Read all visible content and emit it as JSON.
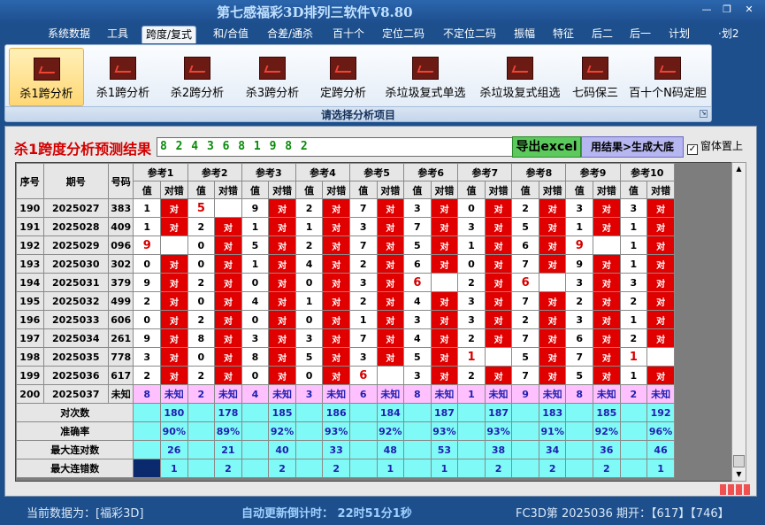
{
  "window": {
    "title": "第七感福彩3D排列三软件V8.80",
    "controls": [
      "—",
      "❐",
      "✕"
    ],
    "extra_tab": "·划2"
  },
  "menu": [
    "系统数据",
    "工具",
    "跨度/复式",
    "和/合值",
    "合差/通杀",
    "百十个",
    "定位二码",
    "不定位二码",
    "振幅",
    "特征",
    "后二",
    "后一",
    "计划"
  ],
  "menu_active_index": 2,
  "ribbon": {
    "buttons": [
      "杀1跨分析",
      "杀1跨分析",
      "杀2跨分析",
      "杀3跨分析",
      "定跨分析",
      "杀垃圾复式单选",
      "杀垃圾复式组选",
      "七码保三",
      "百十个N码定胆"
    ],
    "active_index": 0,
    "group_label": "请选择分析项目",
    "icon": "chart-icon"
  },
  "main": {
    "result_label": "杀1跨度分析预测结果",
    "result_value": "8 2 4 3 6 8 1 9 8 2",
    "export_button": "导出excel",
    "generate_button": "用结果>生成大底",
    "topmost_checkbox_label": "窗体置上",
    "topmost_checked": true
  },
  "table": {
    "headers": {
      "seq": "序号",
      "period": "期号",
      "code": "号码",
      "refs": [
        "参考1",
        "参考2",
        "参考3",
        "参考4",
        "参考5",
        "参考6",
        "参考7",
        "参考8",
        "参考9",
        "参考10"
      ],
      "sub_value": "值",
      "sub_result": "对错"
    },
    "hit_text": "对",
    "rows": [
      {
        "seq": "190",
        "period": "2025027",
        "code": "383",
        "vals": [
          "1",
          "5",
          "9",
          "2",
          "7",
          "3",
          "0",
          "2",
          "3",
          "3"
        ],
        "hits": [
          true,
          false,
          true,
          true,
          true,
          true,
          true,
          true,
          true,
          true
        ],
        "miss_highlight": [
          false,
          true,
          false,
          false,
          false,
          false,
          false,
          false,
          false,
          false
        ]
      },
      {
        "seq": "191",
        "period": "2025028",
        "code": "409",
        "vals": [
          "1",
          "2",
          "1",
          "1",
          "3",
          "7",
          "3",
          "5",
          "1",
          "1"
        ],
        "hits": [
          true,
          true,
          true,
          true,
          true,
          true,
          true,
          true,
          true,
          true
        ],
        "miss_highlight": [
          false,
          false,
          false,
          false,
          false,
          false,
          false,
          false,
          false,
          false
        ]
      },
      {
        "seq": "192",
        "period": "2025029",
        "code": "096",
        "vals": [
          "9",
          "0",
          "5",
          "2",
          "7",
          "5",
          "1",
          "6",
          "9",
          "1"
        ],
        "hits": [
          false,
          true,
          true,
          true,
          true,
          true,
          true,
          true,
          false,
          true
        ],
        "miss_highlight": [
          true,
          false,
          false,
          false,
          false,
          false,
          false,
          false,
          true,
          false
        ]
      },
      {
        "seq": "193",
        "period": "2025030",
        "code": "302",
        "vals": [
          "0",
          "0",
          "1",
          "4",
          "2",
          "6",
          "0",
          "7",
          "9",
          "1"
        ],
        "hits": [
          true,
          true,
          true,
          true,
          true,
          true,
          true,
          true,
          true,
          true
        ],
        "miss_highlight": [
          false,
          false,
          false,
          false,
          false,
          false,
          false,
          false,
          false,
          false
        ]
      },
      {
        "seq": "194",
        "period": "2025031",
        "code": "379",
        "vals": [
          "9",
          "2",
          "0",
          "0",
          "3",
          "6",
          "2",
          "6",
          "3",
          "3"
        ],
        "hits": [
          true,
          true,
          true,
          true,
          true,
          false,
          true,
          false,
          true,
          true
        ],
        "miss_highlight": [
          false,
          false,
          false,
          false,
          false,
          true,
          false,
          true,
          false,
          false
        ]
      },
      {
        "seq": "195",
        "period": "2025032",
        "code": "499",
        "vals": [
          "2",
          "0",
          "4",
          "1",
          "2",
          "4",
          "3",
          "7",
          "2",
          "2"
        ],
        "hits": [
          true,
          true,
          true,
          true,
          true,
          true,
          true,
          true,
          true,
          true
        ],
        "miss_highlight": [
          false,
          false,
          false,
          false,
          false,
          false,
          false,
          false,
          false,
          false
        ]
      },
      {
        "seq": "196",
        "period": "2025033",
        "code": "606",
        "vals": [
          "0",
          "2",
          "0",
          "0",
          "1",
          "3",
          "3",
          "2",
          "3",
          "1"
        ],
        "hits": [
          true,
          true,
          true,
          true,
          true,
          true,
          true,
          true,
          true,
          true
        ],
        "miss_highlight": [
          false,
          false,
          false,
          false,
          false,
          false,
          false,
          false,
          false,
          false
        ]
      },
      {
        "seq": "197",
        "period": "2025034",
        "code": "261",
        "vals": [
          "9",
          "8",
          "3",
          "3",
          "7",
          "4",
          "2",
          "7",
          "6",
          "2"
        ],
        "hits": [
          true,
          true,
          true,
          true,
          true,
          true,
          true,
          true,
          true,
          true
        ],
        "miss_highlight": [
          false,
          false,
          false,
          false,
          false,
          false,
          false,
          false,
          false,
          false
        ]
      },
      {
        "seq": "198",
        "period": "2025035",
        "code": "778",
        "vals": [
          "3",
          "0",
          "8",
          "5",
          "3",
          "5",
          "1",
          "5",
          "7",
          "1"
        ],
        "hits": [
          true,
          true,
          true,
          true,
          true,
          true,
          false,
          true,
          true,
          false
        ],
        "miss_highlight": [
          false,
          false,
          false,
          false,
          false,
          false,
          true,
          false,
          false,
          true
        ]
      },
      {
        "seq": "199",
        "period": "2025036",
        "code": "617",
        "vals": [
          "2",
          "2",
          "0",
          "0",
          "6",
          "3",
          "2",
          "7",
          "5",
          "1"
        ],
        "hits": [
          true,
          true,
          true,
          true,
          false,
          true,
          true,
          true,
          true,
          true
        ],
        "miss_highlight": [
          false,
          false,
          false,
          false,
          true,
          false,
          false,
          false,
          false,
          false
        ]
      }
    ],
    "next_row": {
      "seq": "200",
      "period": "2025037",
      "code": "未知",
      "vals": [
        "8",
        "2",
        "4",
        "3",
        "6",
        "8",
        "1",
        "9",
        "8",
        "2"
      ],
      "unknown_text": "未知"
    },
    "stats": [
      {
        "label": "对次数",
        "values": [
          "180",
          "178",
          "185",
          "186",
          "184",
          "187",
          "187",
          "183",
          "185",
          "192"
        ]
      },
      {
        "label": "准确率",
        "values": [
          "90%",
          "89%",
          "92%",
          "93%",
          "92%",
          "93%",
          "93%",
          "91%",
          "92%",
          "96%"
        ]
      },
      {
        "label": "最大连对数",
        "values": [
          "26",
          "21",
          "40",
          "33",
          "48",
          "53",
          "38",
          "34",
          "36",
          "46"
        ]
      },
      {
        "label": "最大连错数",
        "values": [
          "1",
          "2",
          "2",
          "2",
          "1",
          "1",
          "2",
          "2",
          "2",
          "1"
        ]
      }
    ]
  },
  "status": {
    "current_data": "当前数据为：[福彩3D]",
    "countdown": "自动更新倒计时：  22时51分1秒",
    "draw_info": "FC3D第 2025036 期开：【617】【746】"
  },
  "colors": {
    "background": "#1c4f8c",
    "hit": "#e00000",
    "unknown": "#ffc0ff",
    "stats": "#7ffaf6",
    "excel_button": "#5cc95c",
    "generate_button": "#b6b6f0"
  }
}
